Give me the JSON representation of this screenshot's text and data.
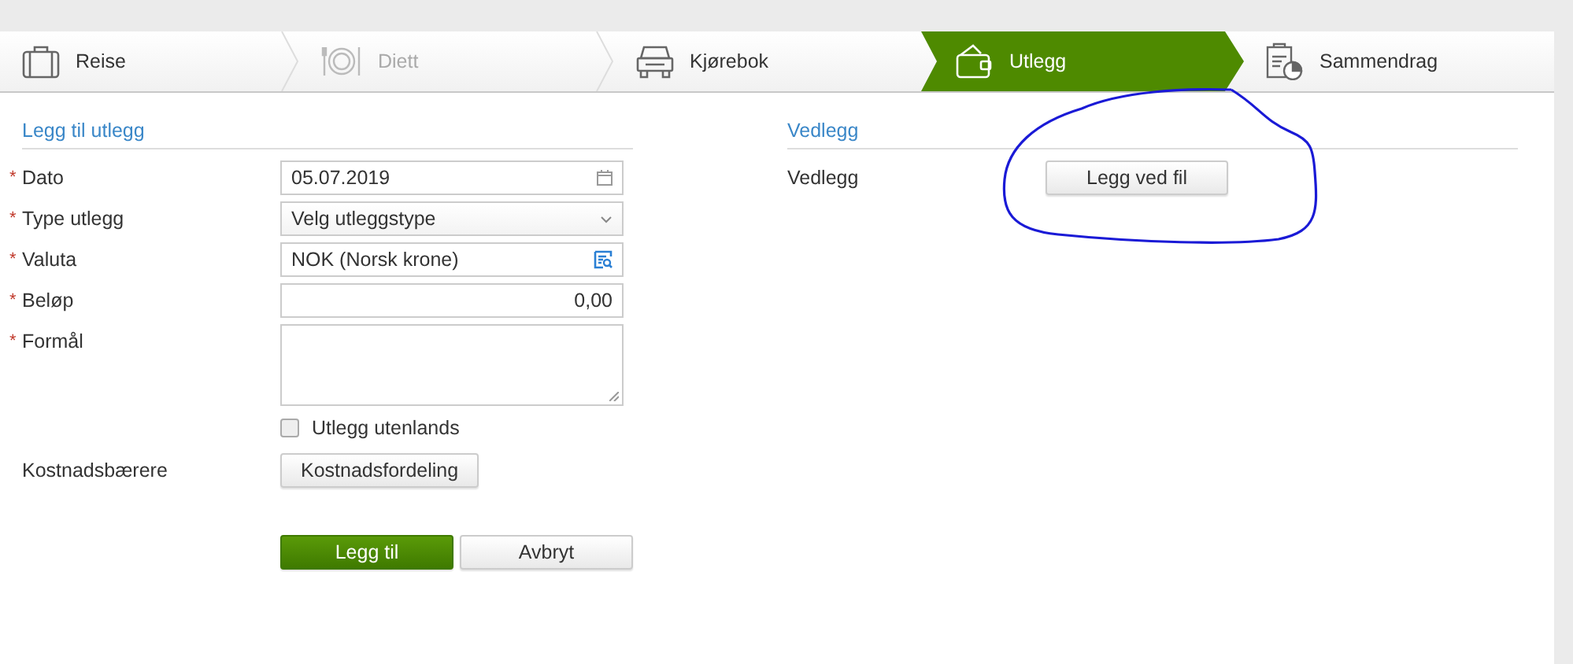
{
  "steps": [
    {
      "label": "Reise",
      "kind": "trip",
      "selected": false,
      "disabled": false
    },
    {
      "label": "Diett",
      "kind": "meals",
      "selected": false,
      "disabled": true
    },
    {
      "label": "Kjørebok",
      "kind": "mileage",
      "selected": false,
      "disabled": false
    },
    {
      "label": "Utlegg",
      "kind": "expense",
      "selected": true,
      "disabled": false
    },
    {
      "label": "Sammendrag",
      "kind": "summary",
      "selected": false,
      "disabled": false
    }
  ],
  "expense_form": {
    "title": "Legg til utlegg",
    "fields": [
      {
        "label": "Dato",
        "marker": "*",
        "kind": "date",
        "value": "05.07.2019"
      },
      {
        "label": "Type utlegg",
        "marker": "*",
        "kind": "select",
        "value": "Velg utleggstype"
      },
      {
        "label": "Valuta",
        "marker": "*",
        "kind": "lookup",
        "value": "NOK (Norsk krone)"
      },
      {
        "label": "Beløp",
        "marker": "*",
        "kind": "number",
        "value": "0,00"
      },
      {
        "label": "Formål",
        "marker": "*",
        "kind": "textarea"
      }
    ],
    "abroad_checkbox": {
      "label": "Utlegg utenlands",
      "checked": false
    },
    "cost_bearers": {
      "label": "Kostnadsbærere",
      "button": "Kostnadsfordeling"
    },
    "actions": [
      {
        "label": "Legg til",
        "kind": "primary"
      },
      {
        "label": "Avbryt",
        "kind": "secondary"
      }
    ]
  },
  "attachments": {
    "title": "Vedlegg",
    "label": "Vedlegg",
    "button": "Legg ved fil"
  }
}
